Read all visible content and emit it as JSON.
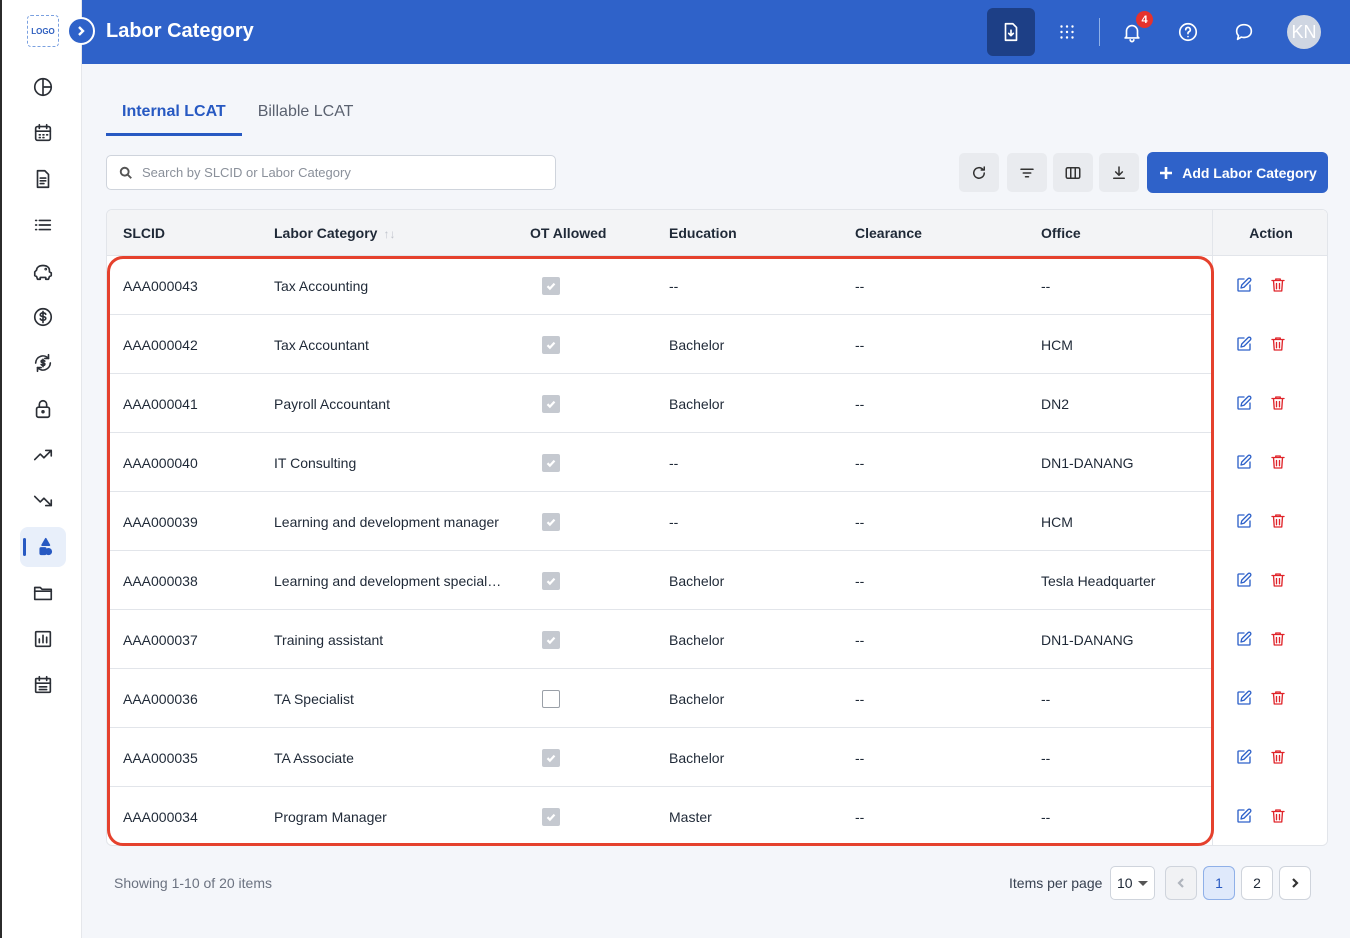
{
  "app": {
    "logo_text": "LOGO",
    "page_title": "Labor Category",
    "user_initials": "KN",
    "notification_count": "4"
  },
  "sidebar": {
    "items": [
      {
        "name": "dashboard-pie-icon"
      },
      {
        "name": "calendar-icon"
      },
      {
        "name": "document-icon"
      },
      {
        "name": "list-icon"
      },
      {
        "name": "piggy-bank-icon"
      },
      {
        "name": "dollar-icon"
      },
      {
        "name": "currency-exchange-icon"
      },
      {
        "name": "lock-icon"
      },
      {
        "name": "trending-up-icon"
      },
      {
        "name": "trending-down-icon"
      },
      {
        "name": "shapes-icon",
        "active": true
      },
      {
        "name": "folder-icon"
      },
      {
        "name": "bar-chart-icon"
      },
      {
        "name": "schedule-icon"
      }
    ]
  },
  "tabs": [
    {
      "label": "Internal LCAT",
      "active": true
    },
    {
      "label": "Billable LCAT",
      "active": false
    }
  ],
  "search": {
    "placeholder": "Search by SLCID or Labor Category",
    "value": ""
  },
  "toolbar": {
    "add_label": "Add Labor Category"
  },
  "table": {
    "columns": {
      "slcid": "SLCID",
      "labor_category": "Labor Category",
      "ot_allowed": "OT Allowed",
      "education": "Education",
      "clearance": "Clearance",
      "office": "Office",
      "action": "Action"
    },
    "rows": [
      {
        "slcid": "AAA000043",
        "category": "Tax Accounting",
        "ot": true,
        "education": "--",
        "clearance": "--",
        "office": "--"
      },
      {
        "slcid": "AAA000042",
        "category": "Tax Accountant",
        "ot": true,
        "education": "Bachelor",
        "clearance": "--",
        "office": "HCM"
      },
      {
        "slcid": "AAA000041",
        "category": "Payroll Accountant",
        "ot": true,
        "education": "Bachelor",
        "clearance": "--",
        "office": "DN2"
      },
      {
        "slcid": "AAA000040",
        "category": "IT Consulting",
        "ot": true,
        "education": "--",
        "clearance": "--",
        "office": "DN1-DANANG"
      },
      {
        "slcid": "AAA000039",
        "category": "Learning and development manager",
        "ot": true,
        "education": "--",
        "clearance": "--",
        "office": "HCM"
      },
      {
        "slcid": "AAA000038",
        "category": "Learning and development special…",
        "ot": true,
        "education": "Bachelor",
        "clearance": "--",
        "office": "Tesla Headquarter"
      },
      {
        "slcid": "AAA000037",
        "category": "Training assistant",
        "ot": true,
        "education": "Bachelor",
        "clearance": "--",
        "office": "DN1-DANANG"
      },
      {
        "slcid": "AAA000036",
        "category": "TA Specialist",
        "ot": false,
        "education": "Bachelor",
        "clearance": "--",
        "office": "--"
      },
      {
        "slcid": "AAA000035",
        "category": "TA Associate",
        "ot": true,
        "education": "Bachelor",
        "clearance": "--",
        "office": "--"
      },
      {
        "slcid": "AAA000034",
        "category": "Program Manager",
        "ot": true,
        "education": "Master",
        "clearance": "--",
        "office": "--"
      }
    ]
  },
  "footer": {
    "showing": "Showing 1-10 of 20 items",
    "items_per_page_label": "Items per page",
    "items_per_page_value": "10",
    "pages": [
      "1",
      "2"
    ],
    "current_page": "1"
  },
  "colors": {
    "primary": "#2f62c9",
    "danger": "#e0242a",
    "highlight": "#e5412d"
  }
}
